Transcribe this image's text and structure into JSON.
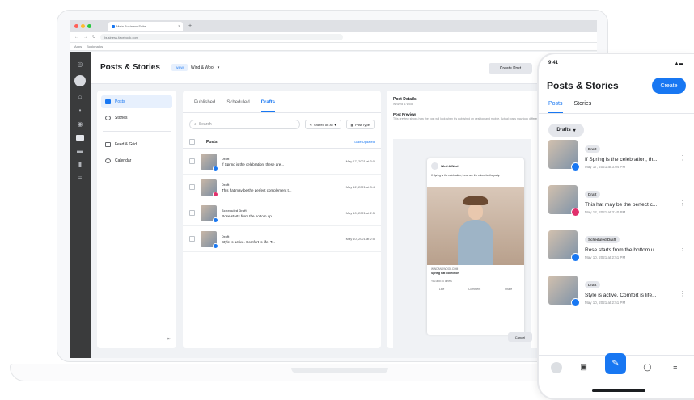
{
  "browser": {
    "tab_title": "Meta Business Suite",
    "url": "business.facebook.com",
    "bookmarks": [
      "Apps",
      "Bookmarks"
    ]
  },
  "app": {
    "page_title": "Posts & Stories",
    "account_name": "Wind & Wool",
    "account_badge": "W&W",
    "create_post": "Create Post"
  },
  "sidenav": {
    "items": [
      {
        "label": "Posts"
      },
      {
        "label": "Stories"
      },
      {
        "label": "Feed & Grid"
      },
      {
        "label": "Calendar"
      }
    ]
  },
  "postlist": {
    "tabs": [
      "Published",
      "Scheduled",
      "Drafts"
    ],
    "active_tab": "Drafts",
    "search_placeholder": "Search",
    "filter_1": "Shared on all",
    "filter_2": "Post Type",
    "header_posts": "Posts",
    "header_date": "Date Updated",
    "rows": [
      {
        "status": "Draft",
        "caption": "If Spring is the celebration, these are...",
        "date": "May 17, 2021 at 3:0"
      },
      {
        "status": "Draft",
        "caption": "This hat may be the perfect complement t...",
        "date": "May 12, 2021 at 3:4"
      },
      {
        "status": "Scheduled Draft",
        "caption": "Rose starts from the bottom up...",
        "date": "May 10, 2021 at 2:5"
      },
      {
        "status": "Draft",
        "caption": "Style is active. Comfort is life. T...",
        "date": "May 10, 2021 at 2:5"
      }
    ]
  },
  "details": {
    "title": "Post Details",
    "subtitle": "W Wind & Wool",
    "preview_title": "Post Preview",
    "preview_sub": "This preview shows how the post will look when it's published on desktop and mobile. Actual posts may look different.",
    "card": {
      "page_name": "Wind & Wool",
      "caption": "If Spring is the celebration, these are the colors for the party.",
      "link_domain": "WINDANDWOOL.COM",
      "link_title": "Spring hat collection",
      "reactions": "You and 40 others",
      "actions": [
        "Like",
        "Comment",
        "Share"
      ]
    },
    "cancel": "Cancel"
  },
  "phone": {
    "time": "9:41",
    "title": "Posts & Stories",
    "create": "Create",
    "tabs": [
      "Posts",
      "Stories"
    ],
    "filter": "Drafts",
    "rows": [
      {
        "status": "Draft",
        "caption": "If Spring is the celebration, th...",
        "date": "May 17, 2021 at 3:04 PM",
        "platform": "facebook"
      },
      {
        "status": "Draft",
        "caption": "This hat may be the perfect c...",
        "date": "May 12, 2021 at 3:40 PM",
        "platform": "instagram"
      },
      {
        "status": "Scheduled Draft",
        "caption": "Rose starts from the bottom u...",
        "date": "May 10, 2021 at 2:51 PM",
        "platform": "facebook"
      },
      {
        "status": "Draft",
        "caption": "Style is active. Comfort is life...",
        "date": "May 10, 2021 at 2:51 PM",
        "platform": "facebook"
      }
    ]
  },
  "colors": {
    "brand_blue": "#1877f2",
    "facebook_badge": "#1877f2",
    "instagram_badge": "#e1306c",
    "rail": "#3a3b3c"
  }
}
